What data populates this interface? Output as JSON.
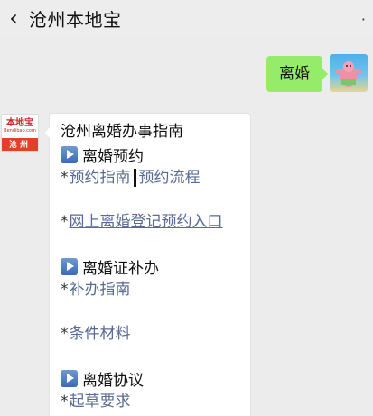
{
  "header": {
    "title": "沧州本地宝",
    "back_icon": "chevron-left-icon",
    "more_icon": "more-dots-icon"
  },
  "sent_message": {
    "text": "离婚",
    "avatar_icon": "user-avatar"
  },
  "bot_avatar": {
    "brand": "本地宝",
    "url": "Bendibao.com",
    "city": "沧州"
  },
  "received_message": {
    "title": "沧州离婚办事指南",
    "sections": [
      {
        "label": "离婚预约",
        "links": [
          {
            "text": "预约指南"
          },
          {
            "text": "预约流程"
          }
        ],
        "link2": "网上离婚登记预约入口"
      },
      {
        "label": "离婚证补办",
        "link1": "补办指南",
        "link2": "条件材料"
      },
      {
        "label": "离婚协议",
        "link1": "起草要求"
      }
    ],
    "bullet": "*"
  },
  "colors": {
    "sent_bubble": "#95ec69",
    "link": "#576b95",
    "background": "#ececec",
    "city_badge": "#e24028"
  }
}
